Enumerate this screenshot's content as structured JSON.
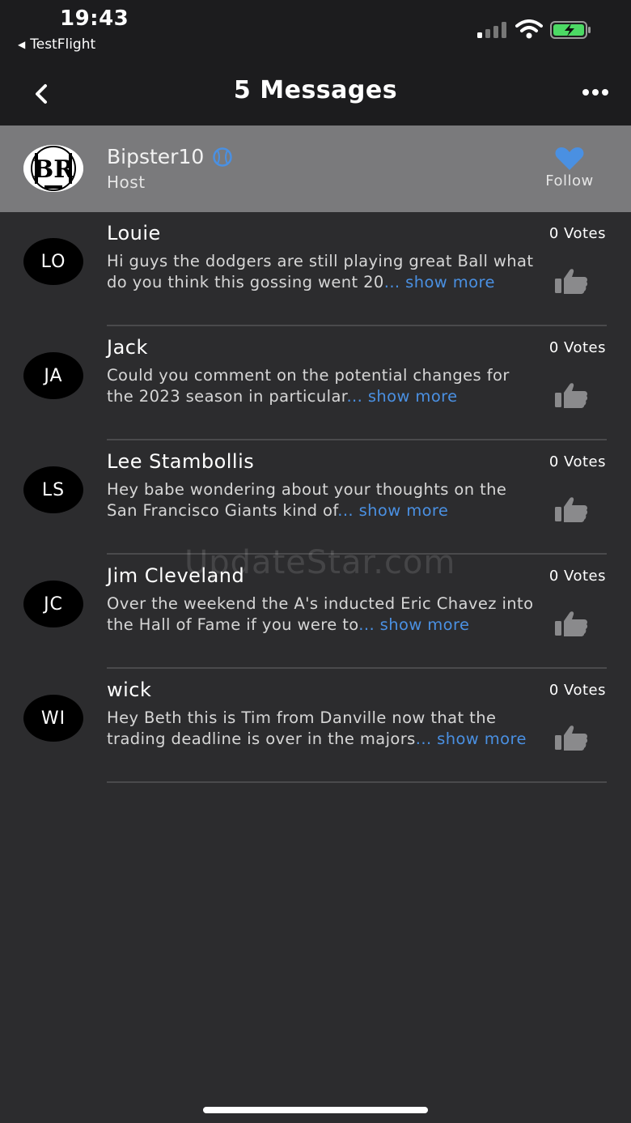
{
  "status": {
    "time": "19:43",
    "back_app": "TestFlight"
  },
  "nav": {
    "title": "5 Messages"
  },
  "host": {
    "name": "Bipster10",
    "role": "Host",
    "follow_label": "Follow"
  },
  "messages": [
    {
      "initials": "LO",
      "name": "Louie",
      "votes": "0 Votes",
      "text": "Hi guys the dodgers are still playing great Ball what do you think this gossing went 20",
      "more": "... show more"
    },
    {
      "initials": "JA",
      "name": "Jack",
      "votes": "0 Votes",
      "text": "Could you comment on the potential changes for the 2023 season in particular",
      "more": "... show more"
    },
    {
      "initials": "LS",
      "name": "Lee Stambollis",
      "votes": "0 Votes",
      "text": "Hey babe wondering about your thoughts on the San Francisco Giants kind of",
      "more": "... show more"
    },
    {
      "initials": "JC",
      "name": "Jim Cleveland",
      "votes": "0 Votes",
      "text": "Over the weekend the A's inducted Eric Chavez into the Hall of Fame if you were to",
      "more": "... show more"
    },
    {
      "initials": "WI",
      "name": "wick",
      "votes": "0 Votes",
      "text": "Hey Beth this is Tim from Danville now that the trading deadline is over in the majors",
      "more": "... show more"
    }
  ],
  "watermark": "UpdateStar.com",
  "colors": {
    "accent": "#4a90e2",
    "background": "#2c2c2e",
    "bar": "#1c1c1e",
    "host_card": "#7a7a7c"
  },
  "icons": {
    "back": "chevron-left-icon",
    "more": "ellipsis-icon",
    "badge": "baseball-icon",
    "follow": "heart-icon",
    "vote": "thumbs-up-icon"
  }
}
